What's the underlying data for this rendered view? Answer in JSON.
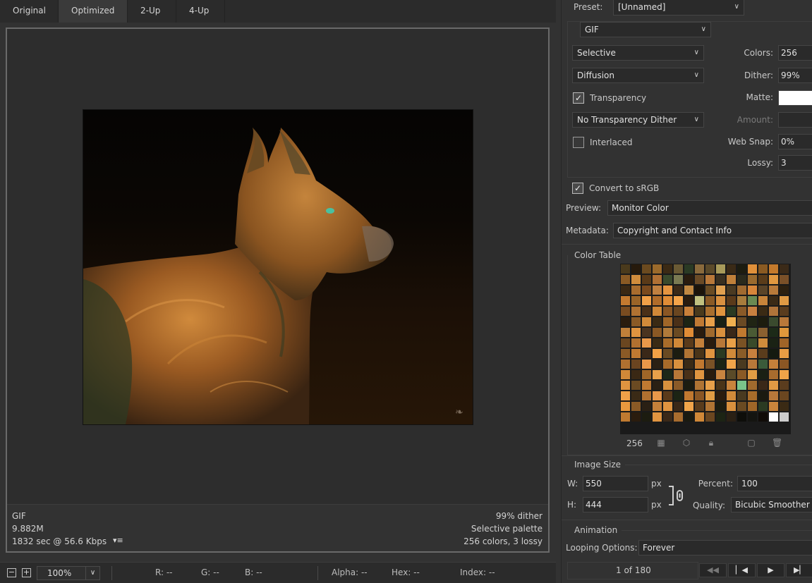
{
  "tabs": [
    "Original",
    "Optimized",
    "2-Up",
    "4-Up"
  ],
  "active_tab": "Optimized",
  "info": {
    "format": "GIF",
    "size": "9.882M",
    "download_time": "1832 sec @ 56.6 Kbps",
    "dither": "99% dither",
    "palette": "Selective palette",
    "colors_lossy": "256 colors, 3 lossy"
  },
  "statusbar": {
    "zoom": "100%",
    "r": "R: --",
    "g": "G: --",
    "b": "B: --",
    "alpha": "Alpha: --",
    "hex": "Hex: --",
    "index": "Index: --"
  },
  "settings": {
    "preset_label": "Preset:",
    "preset_value": "[Unnamed]",
    "format": "GIF",
    "reduction": "Selective",
    "dither_algorithm": "Diffusion",
    "colors_label": "Colors:",
    "colors_value": "256",
    "dither_label": "Dither:",
    "dither_value": "99%",
    "transparency_label": "Transparency",
    "transparency_checked": true,
    "matte_label": "Matte:",
    "matte_color": "#ffffff",
    "transparency_dither": "No Transparency Dither",
    "amount_label": "Amount:",
    "amount_value": "",
    "interlaced_label": "Interlaced",
    "interlaced_checked": false,
    "websnap_label": "Web Snap:",
    "websnap_value": "0%",
    "lossy_label": "Lossy:",
    "lossy_value": "3",
    "convert_srgb_label": "Convert to sRGB",
    "convert_srgb_checked": true,
    "preview_label": "Preview:",
    "preview_value": "Monitor Color",
    "metadata_label": "Metadata:",
    "metadata_value": "Copyright and Contact Info"
  },
  "color_table": {
    "title": "Color Table",
    "count": "256",
    "swatches": [
      "#4a3a1c",
      "#261a0c",
      "#6b4a1f",
      "#9b6a2b",
      "#3b2a14",
      "#6a5a34",
      "#2a3a24",
      "#8a6a3c",
      "#5b4a2a",
      "#a89a5a",
      "#3a2a16",
      "#1c1c10",
      "#e0903a",
      "#8a5a22",
      "#c47a2c",
      "#3b2a18",
      "#8a5a24",
      "#d08c3c",
      "#5a3a18",
      "#b07034",
      "#3a4a2c",
      "#7a7a52",
      "#2a1c0e",
      "#6a4a26",
      "#b8783a",
      "#3a3020",
      "#c0803a",
      "#2a2a1c",
      "#9a6a2e",
      "#5a3c1a",
      "#e09840",
      "#7a5028",
      "#3a2814",
      "#a86c2e",
      "#7a4a1e",
      "#c08040",
      "#e49440",
      "#3b2a18",
      "#c08842",
      "#1c140a",
      "#6a4c24",
      "#e0a050",
      "#4a3a22",
      "#a06a30",
      "#d8863a",
      "#5a4428",
      "#b87a3a",
      "#2c2010",
      "#c47a30",
      "#9a6428",
      "#f0a048",
      "#b06c2a",
      "#e08c36",
      "#f4a44a",
      "#2a1c0e",
      "#c0c080",
      "#8a5a26",
      "#d89040",
      "#5a3a1a",
      "#a87c3c",
      "#6a8a52",
      "#c8843a",
      "#3a2a16",
      "#e09a44",
      "#7a4c20",
      "#b07232",
      "#4a3018",
      "#d08838",
      "#8a5624",
      "#6a4620",
      "#c8803a",
      "#4a3a1c",
      "#a86e2e",
      "#e0943e",
      "#2a3a22",
      "#8a5a28",
      "#c88040",
      "#3a2a14",
      "#b0743a",
      "#5a3c1e",
      "#2a1c0e",
      "#8a5a26",
      "#d08a3a",
      "#3a2a14",
      "#a06628",
      "#4a3018",
      "#1c2414",
      "#c07a34",
      "#e8a04a",
      "#182014",
      "#f0b050",
      "#6a4a24",
      "#202414",
      "#1c1c0e",
      "#3a4a2e",
      "#b8783a",
      "#c0803a",
      "#e09440",
      "#4a3420",
      "#8a5824",
      "#b07a3a",
      "#6a4a22",
      "#e08c36",
      "#2a1c0e",
      "#a06a2e",
      "#d8903e",
      "#3a2818",
      "#c07a30",
      "#4a5a34",
      "#8a6030",
      "#1c2a18",
      "#e0983c",
      "#6a4620",
      "#b07030",
      "#e8984a",
      "#3a2a14",
      "#a86c2a",
      "#d08838",
      "#5a3a1a",
      "#c4803a",
      "#2a1c0e",
      "#b87838",
      "#e8a048",
      "#7a5224",
      "#3a4a2a",
      "#d08c3c",
      "#1a2214",
      "#a06428",
      "#8a5a26",
      "#c07a32",
      "#3a2818",
      "#f0a046",
      "#6a4a22",
      "#1c1c10",
      "#b07434",
      "#4a3418",
      "#e09440",
      "#2a3a22",
      "#d08a3a",
      "#8a5c28",
      "#c8803e",
      "#5a3c1c",
      "#141a10",
      "#e89c44",
      "#b07030",
      "#6a4420",
      "#e8984a",
      "#2a2014",
      "#a86a2a",
      "#d8903e",
      "#3a2a16",
      "#c07830",
      "#7a5226",
      "#1c2414",
      "#f0a44a",
      "#4a3a20",
      "#b8783a",
      "#3a5a3a",
      "#c4803a",
      "#8a5624",
      "#d08838",
      "#3a2814",
      "#a06628",
      "#e8a04a",
      "#1c2818",
      "#b87838",
      "#4a3018",
      "#e09440",
      "#2a1c0e",
      "#c88440",
      "#5a4a28",
      "#8a5a26",
      "#e09c44",
      "#1a2014",
      "#a86c2e",
      "#f0a448",
      "#e09440",
      "#6a4a22",
      "#c07a32",
      "#2a2014",
      "#d8903e",
      "#8a5a28",
      "#1c1c10",
      "#b07434",
      "#e8a04a",
      "#4a3418",
      "#c8843c",
      "#7ac48a",
      "#a06a2e",
      "#3a2818",
      "#e09a44",
      "#5a3c1e",
      "#f0a048",
      "#3a2a16",
      "#b07030",
      "#e8984a",
      "#5a3a1a",
      "#1c2414",
      "#c07830",
      "#8a5624",
      "#e09c44",
      "#2a1c0e",
      "#d08a3a",
      "#4a3a20",
      "#a86c2a",
      "#1a1a10",
      "#b8783a",
      "#6a4620",
      "#e8983e",
      "#8a5a26",
      "#2a2014",
      "#c4803a",
      "#e09440",
      "#3a2818",
      "#f0a44a",
      "#5a3c1c",
      "#b07434",
      "#1c1c10",
      "#d8903e",
      "#6a4a22",
      "#a06628",
      "#2a3a22",
      "#c8843c",
      "#3a2a14",
      "#c07a30",
      "#2a1c0e",
      "#1c1c10",
      "#e09440",
      "#3a2818",
      "#a86c2e",
      "#1a1a10",
      "#d08838",
      "#6a4620",
      "#1c2414",
      "#2a2014",
      "#0e0e0a",
      "#141410",
      "#100c08",
      "#ffffff",
      "#cccccc"
    ]
  },
  "image_size": {
    "title": "Image Size",
    "w_label": "W:",
    "w_value": "550",
    "h_label": "H:",
    "h_value": "444",
    "unit": "px",
    "percent_label": "Percent:",
    "percent_value": "100",
    "quality_label": "Quality:",
    "quality_value": "Bicubic Smoother"
  },
  "animation": {
    "title": "Animation",
    "looping_label": "Looping Options:",
    "looping_value": "Forever",
    "frame_counter": "1 of 180"
  }
}
